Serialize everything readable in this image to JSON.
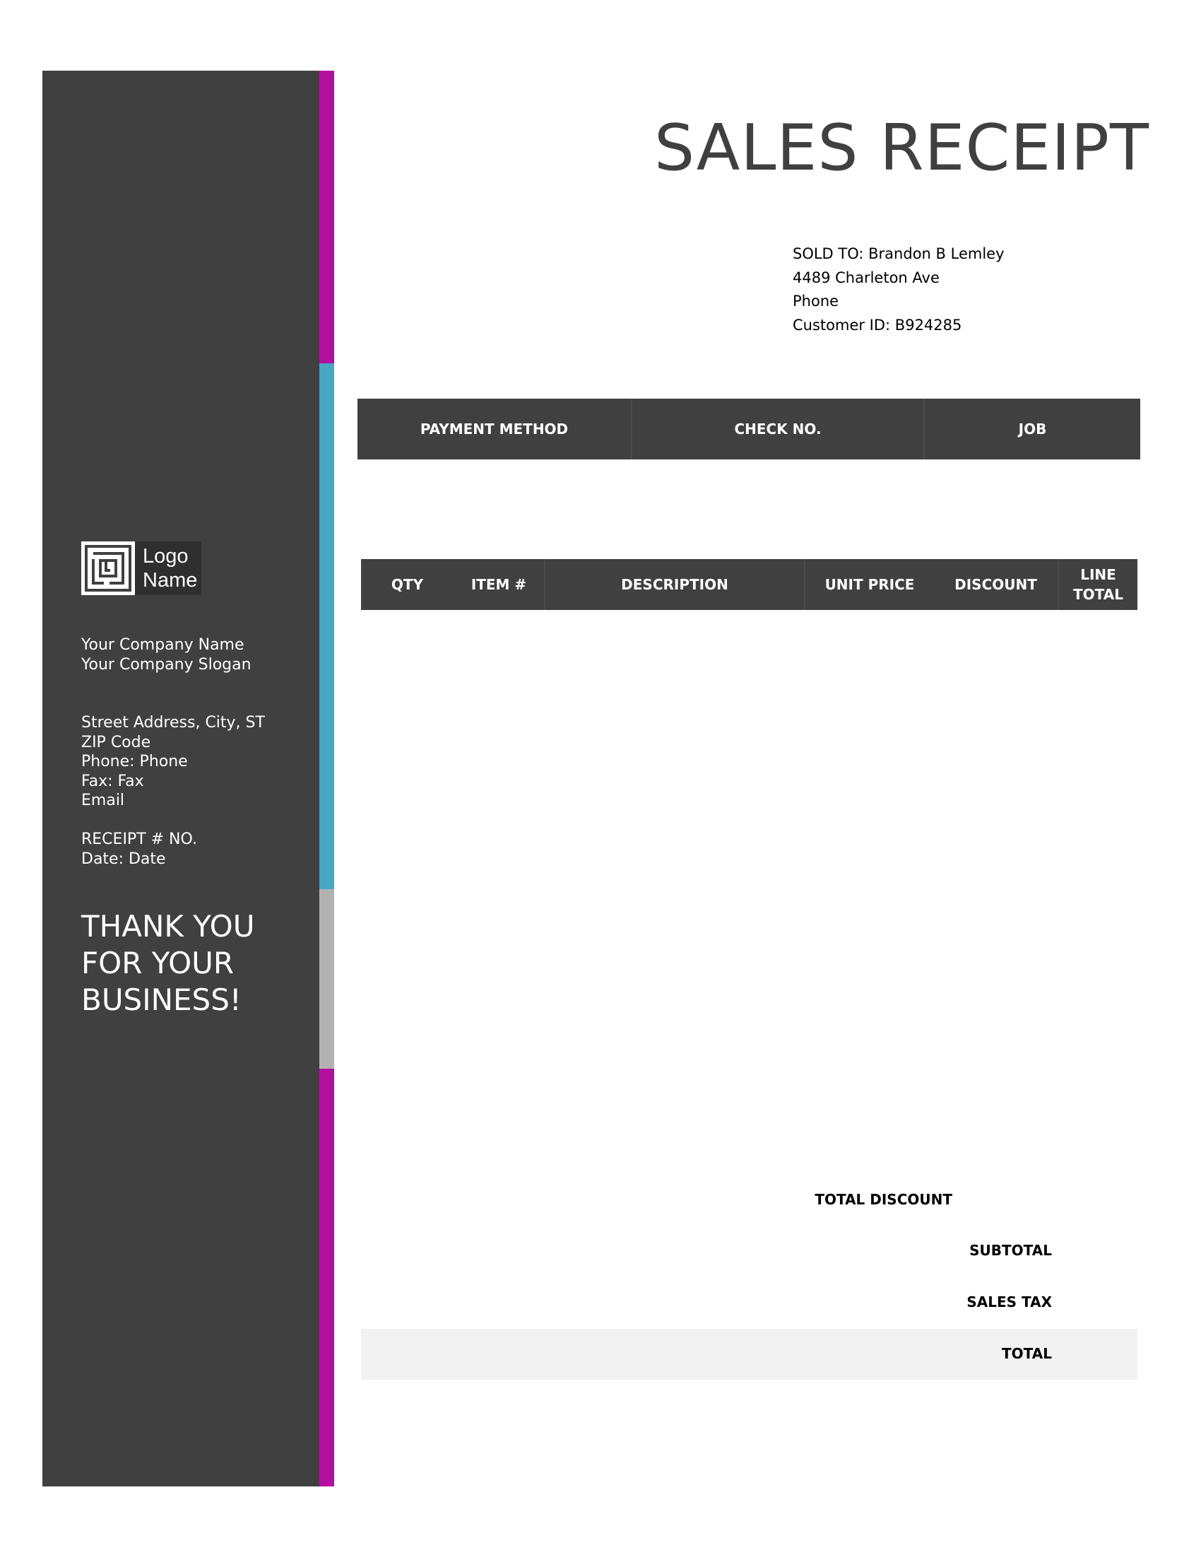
{
  "colors": {
    "sidebar": "#404040",
    "accent_magenta": "#b4109f",
    "accent_blue": "#4aa7c4",
    "accent_gray": "#b2b2b2",
    "header_bg": "#404040",
    "total_band": "#f2f2f2",
    "title": "#404040"
  },
  "title": "SALES RECEIPT",
  "sold_to": {
    "line1": "SOLD TO: Brandon B Lemley",
    "line2": "4489  Charleton Ave",
    "line3": "Phone",
    "line4": "Customer ID: B924285"
  },
  "payment_table": {
    "headers": [
      "PAYMENT METHOD",
      "CHECK NO.",
      "JOB"
    ]
  },
  "items_table": {
    "headers": [
      "QTY",
      "ITEM #",
      "DESCRIPTION",
      "UNIT PRICE",
      "DISCOUNT",
      "LINE",
      "TOTAL"
    ]
  },
  "totals": {
    "total_discount": "TOTAL DISCOUNT",
    "subtotal": "SUBTOTAL",
    "sales_tax": "SALES TAX",
    "total": "TOTAL"
  },
  "sidebar": {
    "logo": {
      "icon": "maze-logo-icon",
      "line1": "Logo",
      "line2": "Name"
    },
    "company_name": "Your Company Name",
    "company_slogan": "Your Company Slogan",
    "street": "Street Address, City, ST",
    "zip": "ZIP Code",
    "phone": "Phone: Phone",
    "fax": "Fax: Fax",
    "email": "Email",
    "receipt_no": "RECEIPT # NO.",
    "date": "Date: Date",
    "thanks": [
      "THANK YOU",
      "FOR YOUR",
      "BUSINESS!"
    ]
  }
}
